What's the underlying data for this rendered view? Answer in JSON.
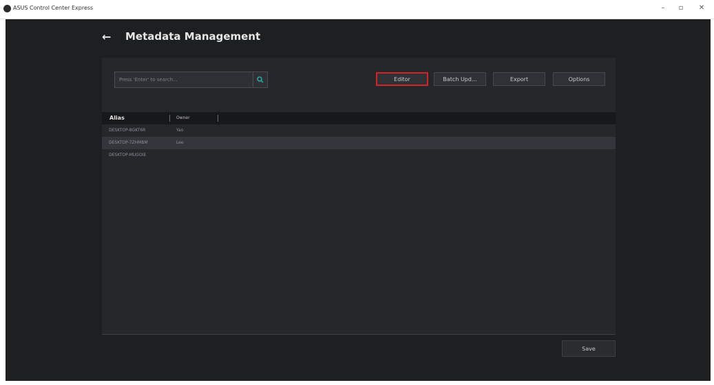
{
  "window": {
    "title": "ASUS Control Center Express",
    "min_symbol": "–",
    "max_symbol": "▫",
    "close_symbol": "✕"
  },
  "header": {
    "back_symbol": "←",
    "title": "Metadata Management"
  },
  "search": {
    "placeholder": "Press 'Enter' to search..."
  },
  "toolbar": {
    "editor": "Editor",
    "batch_update": "Batch Upd...",
    "export": "Export",
    "options": "Options"
  },
  "table": {
    "columns": [
      "Alias",
      "Owner"
    ],
    "rows": [
      {
        "alias": "DESKTOP-8GKT6R",
        "owner": "Yao"
      },
      {
        "alias": "DESKTOP-7ZHMBM",
        "owner": "Lee"
      },
      {
        "alias": "DESKTOP-MUGOIE",
        "owner": ""
      }
    ]
  },
  "footer": {
    "save": "Save"
  },
  "colors": {
    "background": "#1e1f21",
    "panel": "#25272b",
    "active_outline": "#d42525",
    "search_icon": "#2aa7a0"
  }
}
